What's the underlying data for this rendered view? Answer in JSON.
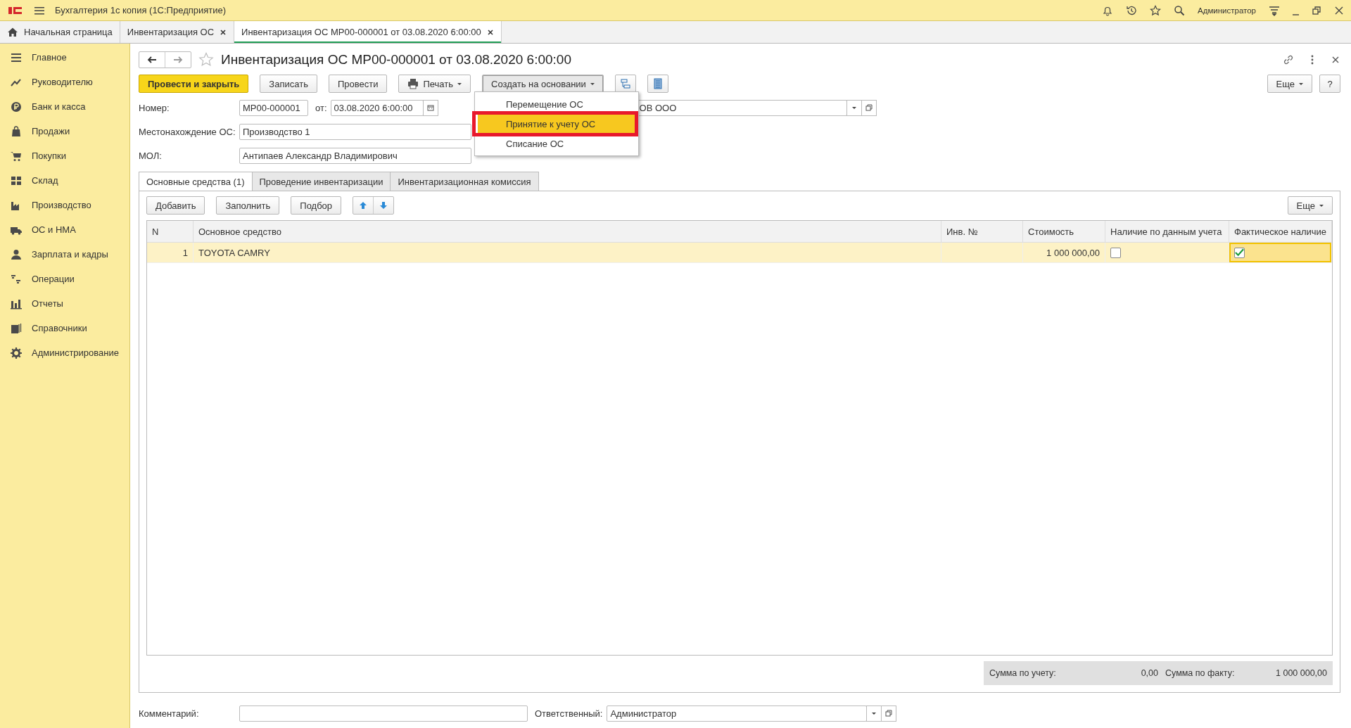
{
  "app": {
    "title": "Бухгалтерия 1с копия  (1С:Предприятие)",
    "user": "Администратор"
  },
  "open_tabs": [
    {
      "label": "Начальная страница",
      "selected": false,
      "kind": "home"
    },
    {
      "label": "Инвентаризация ОС",
      "selected": false,
      "kind": "doc"
    },
    {
      "label": "Инвентаризация ОС МР00-000001 от 03.08.2020 6:00:00",
      "selected": true,
      "kind": "doc"
    }
  ],
  "sidebar": {
    "items": [
      {
        "label": "Главное"
      },
      {
        "label": "Руководителю"
      },
      {
        "label": "Банк и касса"
      },
      {
        "label": "Продажи"
      },
      {
        "label": "Покупки"
      },
      {
        "label": "Склад"
      },
      {
        "label": "Производство"
      },
      {
        "label": "ОС и НМА"
      },
      {
        "label": "Зарплата и кадры"
      },
      {
        "label": "Операции"
      },
      {
        "label": "Отчеты"
      },
      {
        "label": "Справочники"
      },
      {
        "label": "Администрирование"
      }
    ]
  },
  "form": {
    "title": "Инвентаризация ОС МР00-000001 от 03.08.2020 6:00:00",
    "actions": [
      {
        "label": "Провести и закрыть",
        "kind": "primary",
        "selected": false
      },
      {
        "label": "Записать",
        "kind": "plain",
        "selected": false
      },
      {
        "label": "Провести",
        "kind": "plain",
        "selected": false
      },
      {
        "label": "Печать",
        "kind": "print",
        "selected": false
      },
      {
        "label": "Создать на основании",
        "kind": "dropdown",
        "selected": true
      }
    ],
    "more": "Еще",
    "help": "?",
    "number_label": "Номер:",
    "number": "МР00-000001",
    "date_label": "от:",
    "date": "03.08.2020  6:00:00",
    "organization": "ОВ ООО",
    "location_label": "Местонахождение ОС:",
    "location": "Производство 1",
    "mol_label": "МОЛ:",
    "mol": "Антипаев Александр Владимирович",
    "create_menu": [
      {
        "label": "Перемещение ОС",
        "selected": false,
        "outlined": false
      },
      {
        "label": "Принятие к учету ОС",
        "selected": true,
        "outlined": true
      },
      {
        "label": "Списание ОС",
        "selected": false,
        "outlined": false
      }
    ],
    "tabs": [
      {
        "label": "Основные средства (1)",
        "selected": true
      },
      {
        "label": "Проведение инвентаризации",
        "selected": false
      },
      {
        "label": "Инвентаризационная комиссия",
        "selected": false
      }
    ],
    "table_buttons": [
      "Добавить",
      "Заполнить",
      "Подбор"
    ],
    "table_more": "Еще",
    "table": {
      "columns": [
        "N",
        "Основное средство",
        "Инв. №",
        "Стоимость",
        "Наличие по данным учета",
        "Фактическое наличие"
      ],
      "rows": [
        {
          "n": "1",
          "asset": "TOYOTA CAMRY",
          "cost": "1 000 000,00",
          "on_record": false,
          "actual": true,
          "selected": true
        }
      ]
    },
    "totals": [
      {
        "label": "Сумма по учету:",
        "value": "0,00"
      },
      {
        "label": "Сумма по факту:",
        "value": "1 000 000,00"
      }
    ],
    "comment_label": "Комментарий:",
    "responsible_label": "Ответственный:",
    "responsible": "Администратор"
  }
}
